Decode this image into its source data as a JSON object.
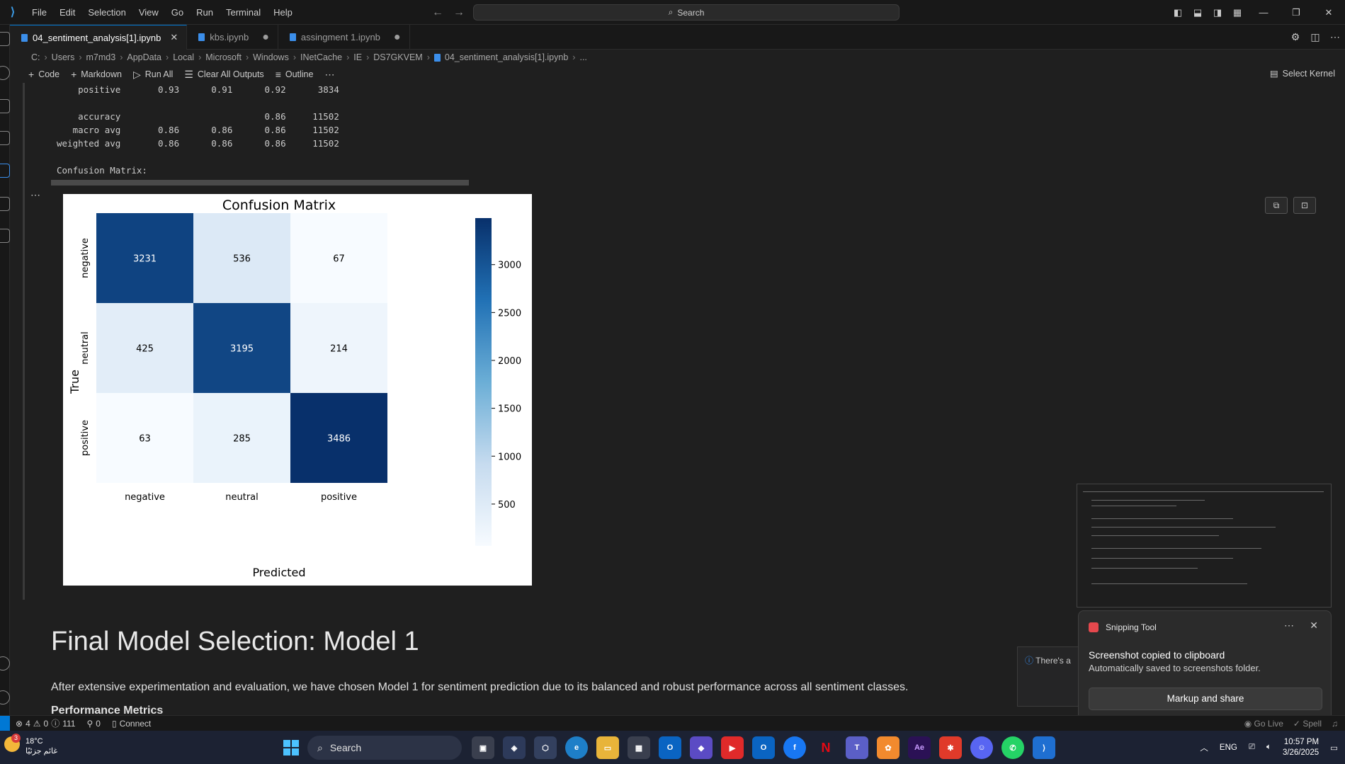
{
  "titlebar": {
    "menu": [
      "File",
      "Edit",
      "Selection",
      "View",
      "Go",
      "Run",
      "Terminal",
      "Help"
    ],
    "search_label": "Search"
  },
  "tabs": [
    {
      "label": "04_sentiment_analysis[1].ipynb",
      "active": true
    },
    {
      "label": "kbs.ipynb",
      "active": false
    },
    {
      "label": "assingment 1.ipynb",
      "active": false
    }
  ],
  "breadcrumb": [
    "C:",
    "Users",
    "m7md3",
    "AppData",
    "Local",
    "Microsoft",
    "Windows",
    "INetCache",
    "IE",
    "DS7GKVEM",
    "04_sentiment_analysis[1].ipynb",
    "..."
  ],
  "toolbar": {
    "code": "Code",
    "markdown": "Markdown",
    "run_all": "Run All",
    "clear_outputs": "Clear All Outputs",
    "outline": "Outline",
    "select_kernel": "Select Kernel"
  },
  "output_text": "    positive       0.93      0.91      0.92      3834\n\n    accuracy                           0.86     11502\n   macro avg       0.86      0.86      0.86     11502\nweighted avg       0.86      0.86      0.86     11502\n\nConfusion Matrix:",
  "chart_data": {
    "type": "heatmap",
    "title": "Confusion Matrix",
    "xlabel": "Predicted",
    "ylabel": "True",
    "x_categories": [
      "negative",
      "neutral",
      "positive"
    ],
    "y_categories": [
      "negative",
      "neutral",
      "positive"
    ],
    "values": [
      [
        3231,
        536,
        67
      ],
      [
        425,
        3195,
        214
      ],
      [
        63,
        285,
        3486
      ]
    ],
    "colormap": "Blues",
    "colorbar_ticks": [
      500,
      1000,
      1500,
      2000,
      2500,
      3000
    ],
    "colorbar_range": [
      63,
      3486
    ]
  },
  "markdown": {
    "heading": "Final Model Selection: Model 1",
    "paragraph": "After extensive experimentation and evaluation, we have chosen Model 1 for sentiment prediction due to its balanced and robust performance across all sentiment classes.",
    "subheading": "Performance Metrics"
  },
  "info_notification": "There's a",
  "snipping": {
    "app": "Snipping Tool",
    "heading": "Screenshot copied to clipboard",
    "sub": "Automatically saved to screenshots folder.",
    "button": "Markup and share"
  },
  "statusbar": {
    "errors": "4",
    "warnings": "0",
    "info": "111",
    "ports": "0",
    "connect": "Connect",
    "go_live": "Go Live",
    "spell": "Spell"
  },
  "taskbar": {
    "temperature": "18°C",
    "weather_desc": "غائم جزئيًا",
    "weather_badge": "3",
    "search": "Search",
    "lang": "ENG",
    "time": "10:57 PM",
    "date": "3/26/2025"
  }
}
